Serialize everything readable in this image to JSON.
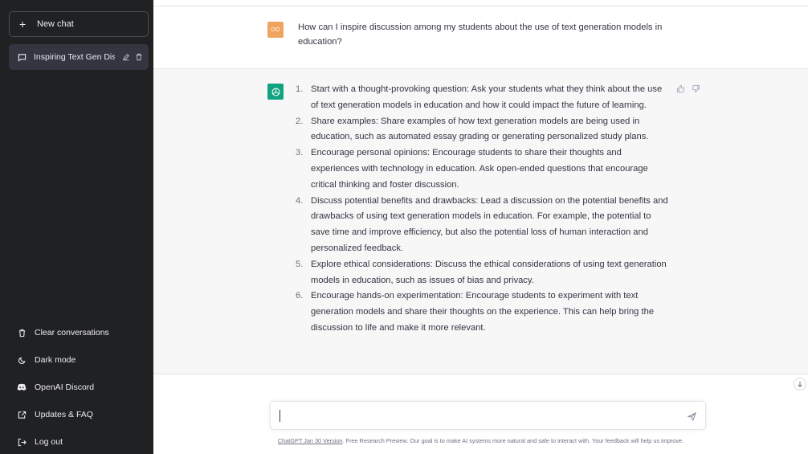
{
  "sidebar": {
    "new_chat_label": "New chat",
    "conversations": [
      {
        "title": "Inspiring Text Gen Dis"
      }
    ],
    "bottom_links": [
      {
        "label": "Clear conversations",
        "icon": "trash-icon"
      },
      {
        "label": "Dark mode",
        "icon": "moon-icon"
      },
      {
        "label": "OpenAI Discord",
        "icon": "discord-icon"
      },
      {
        "label": "Updates & FAQ",
        "icon": "external-link-icon"
      },
      {
        "label": "Log out",
        "icon": "logout-icon"
      }
    ]
  },
  "chat": {
    "user_avatar_text": "DO",
    "user_message": "How can I inspire discussion among my students about the use of text generation models in education?",
    "answer_items": [
      {
        "num": "1.",
        "text": "Start with a thought-provoking question: Ask your students what they think about the use of text generation models in education and how it could impact the future of learning."
      },
      {
        "num": "2.",
        "text": "Share examples: Share examples of how text generation models are being used in education, such as automated essay grading or generating personalized study plans."
      },
      {
        "num": "3.",
        "text": "Encourage personal opinions: Encourage students to share their thoughts and experiences with technology in education. Ask open-ended questions that encourage critical thinking and foster discussion."
      },
      {
        "num": "4.",
        "text": "Discuss potential benefits and drawbacks: Lead a discussion on the potential benefits and drawbacks of using text generation models in education. For example, the potential to save time and improve efficiency, but also the potential loss of human interaction and personalized feedback."
      },
      {
        "num": "5.",
        "text": "Explore ethical considerations: Discuss the ethical considerations of using text generation models in education, such as issues of bias and privacy."
      },
      {
        "num": "6.",
        "text": "Encourage hands-on experimentation: Encourage students to experiment with text generation models and share their thoughts on the experience. This can help bring the discussion to life and make it more relevant."
      }
    ]
  },
  "composer": {
    "value": "",
    "placeholder": ""
  },
  "footer": {
    "version_link": "ChatGPT Jan 30 Version",
    "text": ". Free Research Preview. Our goal is to make AI systems more natural and safe to interact with. Your feedback will help us improve."
  },
  "colors": {
    "sidebar_bg": "#202123",
    "active_item_bg": "#343541",
    "ai_avatar": "#10a37f",
    "user_avatar": "#f0a35e",
    "answer_bg": "#f7f7f8"
  }
}
